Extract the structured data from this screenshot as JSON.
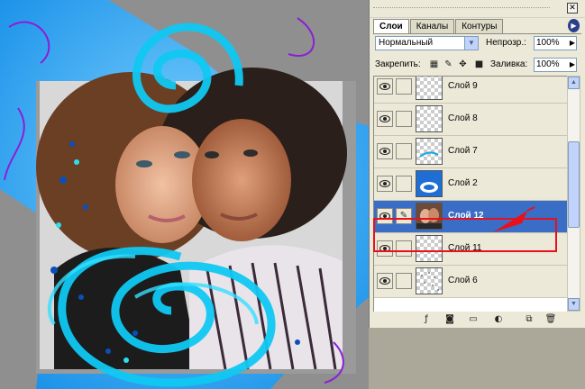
{
  "palette": {
    "tabs": [
      {
        "label": "Слои",
        "active": true
      },
      {
        "label": "Каналы",
        "active": false
      },
      {
        "label": "Контуры",
        "active": false
      }
    ],
    "blend_mode": "Нормальный",
    "opacity_label": "Непрозр.:",
    "opacity_value": "100%",
    "lock_label": "Закрепить:",
    "fill_label": "Заливка:",
    "fill_value": "100%",
    "layers": [
      {
        "name": "Слой 9",
        "selected": false
      },
      {
        "name": "Слой 8",
        "selected": false
      },
      {
        "name": "Слой 7",
        "selected": false
      },
      {
        "name": "Слой 2",
        "selected": false
      },
      {
        "name": "Слой 12",
        "selected": true
      },
      {
        "name": "Слой 11",
        "selected": false
      },
      {
        "name": "Слой 6",
        "selected": false
      }
    ]
  },
  "colors": {
    "accent": "#3a6ec6",
    "highlight_border": "#e8101a",
    "canvas_blue": "#1fa3f0"
  },
  "icons": [
    "eye-icon",
    "link-icon",
    "lock-transparency-icon",
    "lock-paint-icon",
    "lock-move-icon",
    "lock-all-icon",
    "layer-style-icon",
    "mask-icon",
    "new-group-icon",
    "adjustment-icon",
    "new-layer-icon",
    "trash-icon",
    "palette-menu-icon",
    "close-icon"
  ]
}
